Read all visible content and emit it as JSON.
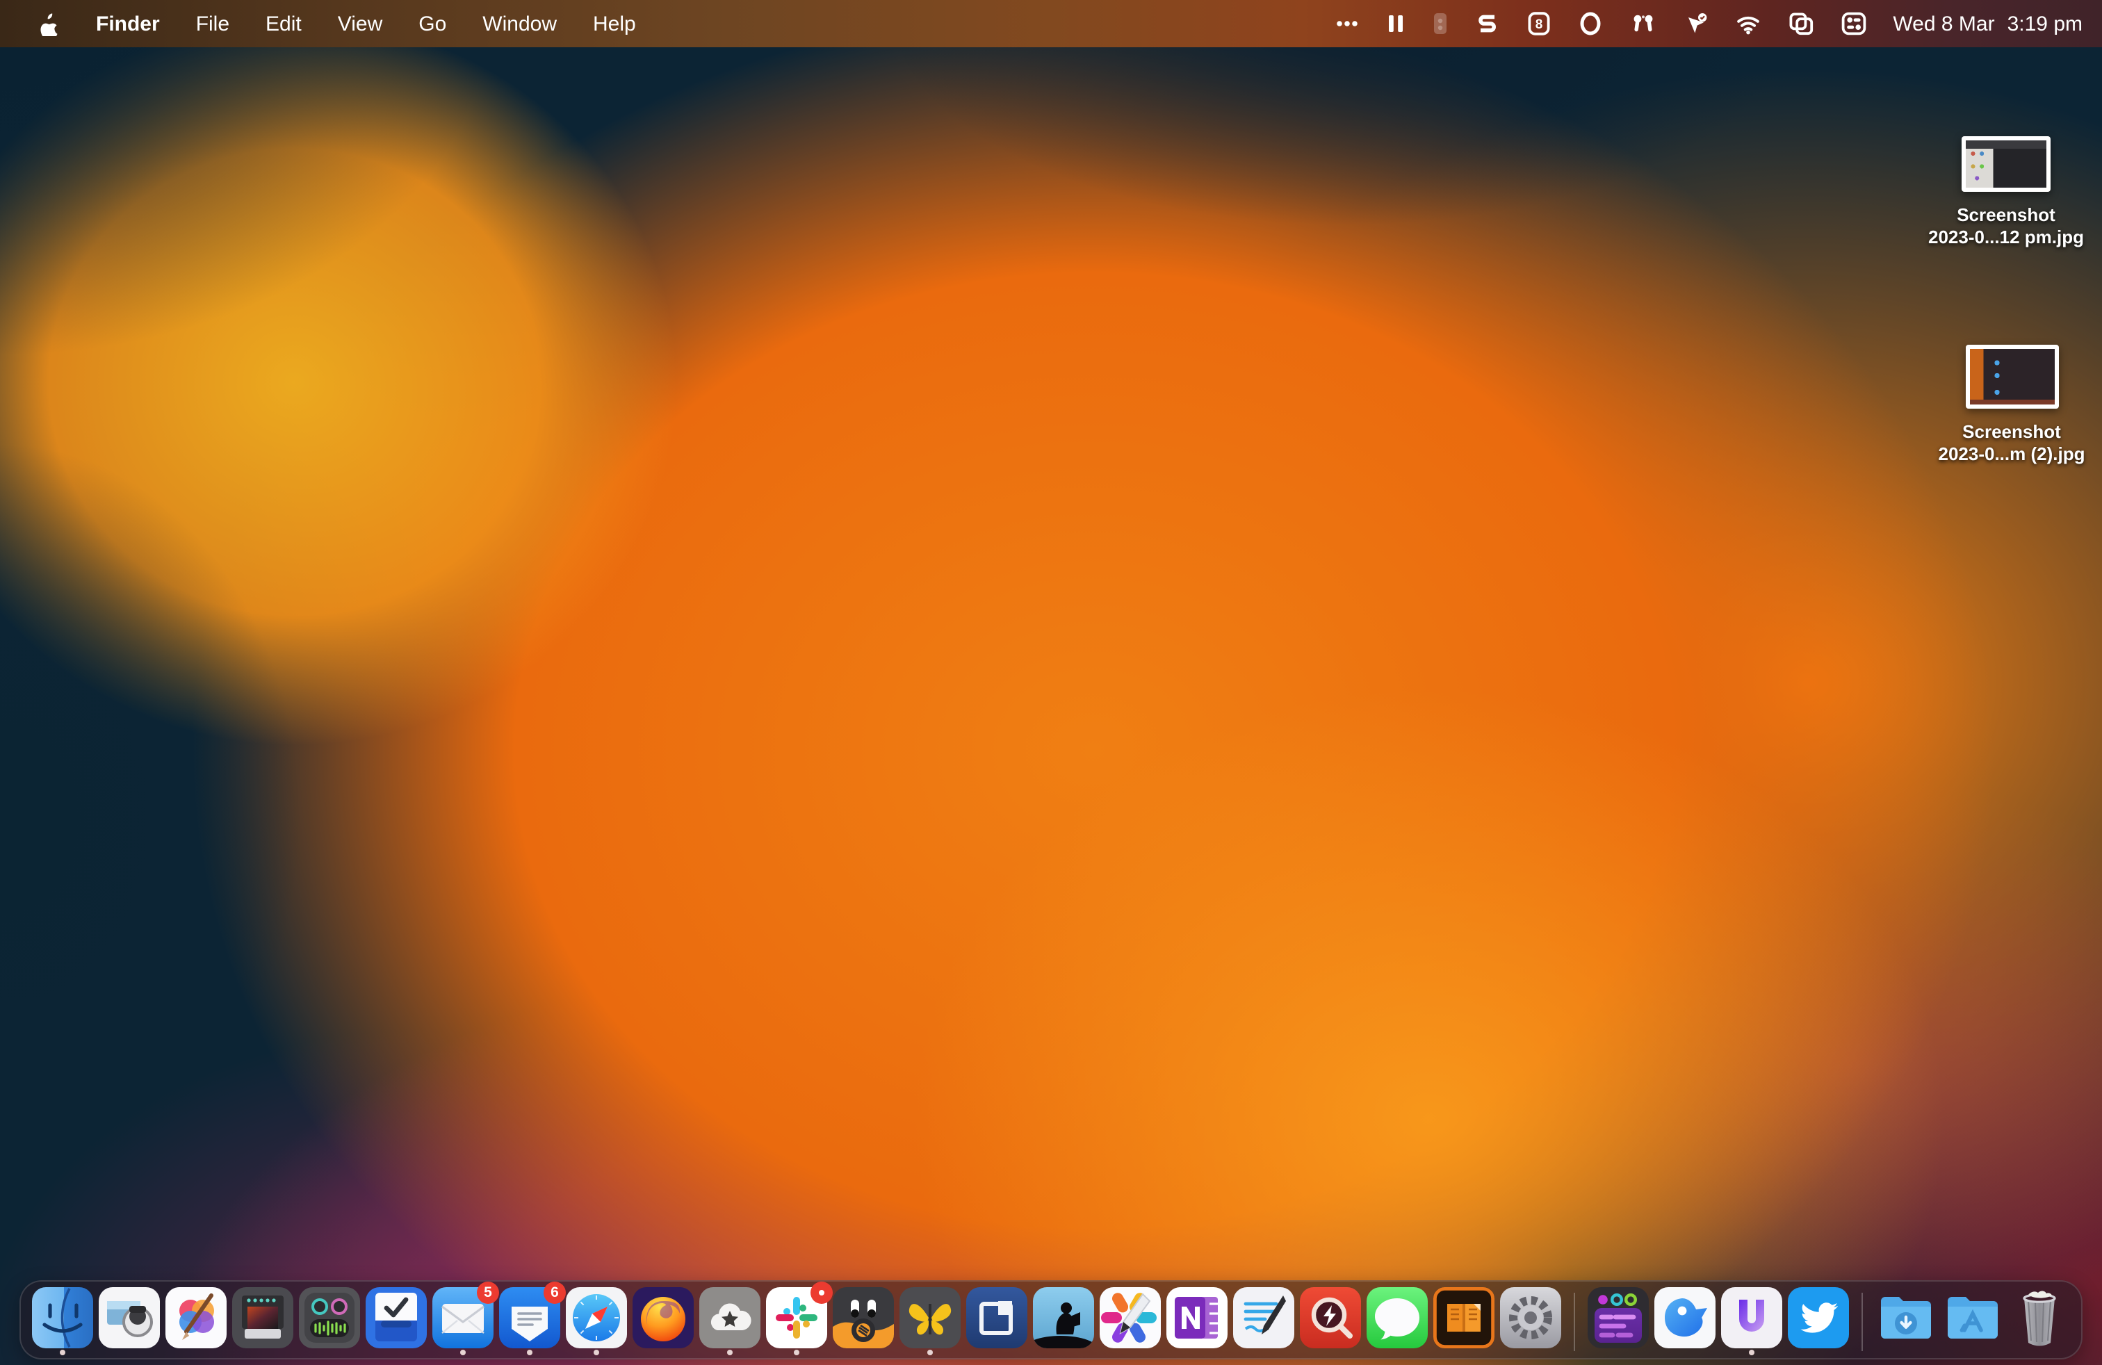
{
  "menu_bar": {
    "app_menu": "Finder",
    "menus": [
      "File",
      "Edit",
      "View",
      "Go",
      "Window",
      "Help"
    ],
    "status_icon_names": [
      "more-status-icon",
      "pause-icon",
      "device-status-icon",
      "stage-s-icon",
      "calendar-8-icon",
      "ring-icon",
      "airpods-icon",
      "location-check-icon",
      "wifi-icon",
      "screen-mirroring-icon",
      "control-center-icon"
    ],
    "status_badge_8": "8",
    "clock_date": "Wed 8 Mar",
    "clock_time": "3:19 pm"
  },
  "desktop": {
    "files": [
      {
        "line1": "Screenshot",
        "line2": "2023-0...12 pm.jpg"
      },
      {
        "line1": "Screenshot",
        "line2": "2023-0...m (2).jpg"
      }
    ]
  },
  "dock": {
    "icon_names": [
      "finder",
      "preview",
      "pixelmator",
      "printer-photo",
      "audio-robot",
      "things",
      "mail",
      "spark",
      "safari",
      "firefox",
      "cloud-star",
      "slack",
      "camera-robot",
      "ulysses",
      "window-manager",
      "kindle",
      "highlights",
      "onenote",
      "notability",
      "capture-loupe",
      "messages",
      "ebook-reader",
      "system-settings",
      "purple-tasks",
      "blue-bird",
      "u-launcher",
      "twitter",
      "downloads-folder",
      "applications-folder",
      "trash"
    ],
    "running_apps": [
      "finder",
      "mail",
      "spark",
      "safari",
      "cloud-star",
      "slack",
      "ulysses",
      "u-launcher"
    ],
    "badges": {
      "mail": "5",
      "spark": "6",
      "slack": "dot"
    }
  },
  "colors": {
    "menu_bar_left": "#3a2817",
    "menu_bar_mid": "#8f431d",
    "menu_bar_right": "#402329",
    "dock_bg": "rgba(32,26,36,0.55)",
    "badge_red": "#ec3b30",
    "wallpaper_navy": "#0c2434",
    "wallpaper_orange": "#ee7012",
    "wallpaper_magenta": "#a63a68"
  }
}
